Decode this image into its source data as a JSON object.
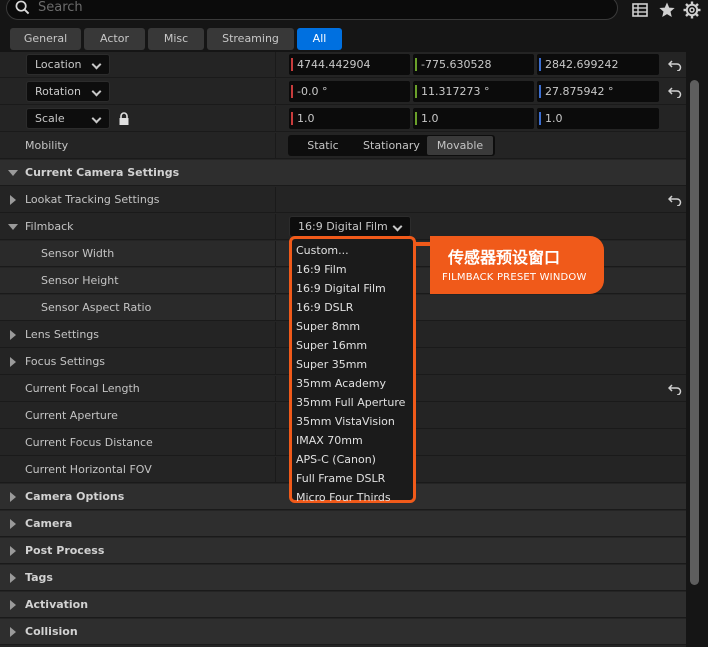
{
  "search": {
    "placeholder": "Search"
  },
  "toolbar_icons": [
    "table-icon",
    "star-icon",
    "gear-icon"
  ],
  "tabs": [
    {
      "label": "General",
      "active": false
    },
    {
      "label": "Actor",
      "active": false
    },
    {
      "label": "Misc",
      "active": false
    },
    {
      "label": "Streaming",
      "active": false
    },
    {
      "label": "All",
      "active": true
    }
  ],
  "transform": {
    "location": {
      "label": "Location",
      "x": "4744.442904",
      "y": "-775.630528",
      "z": "2842.699242"
    },
    "rotation": {
      "label": "Rotation",
      "x": "-0.0 °",
      "y": "11.317273 °",
      "z": "27.875942 °"
    },
    "scale": {
      "label": "Scale",
      "x": "1.0",
      "y": "1.0",
      "z": "1.0"
    },
    "mobility": {
      "label": "Mobility",
      "options": [
        "Static",
        "Stationary",
        "Movable"
      ],
      "selected": "Movable"
    }
  },
  "sections": {
    "current_camera_settings": "Current Camera Settings",
    "lookat_tracking": "Lookat Tracking Settings",
    "filmback": "Filmback",
    "filmback_value": "16:9 Digital Film",
    "sensor_width": "Sensor Width",
    "sensor_height": "Sensor Height",
    "sensor_aspect_ratio": "Sensor Aspect Ratio",
    "lens_settings": "Lens Settings",
    "focus_settings": "Focus Settings",
    "current_focal_length": "Current Focal Length",
    "current_aperture": "Current Aperture",
    "current_focus_distance": "Current Focus Distance",
    "current_horizontal_fov": "Current Horizontal FOV",
    "camera_options": "Camera Options",
    "camera": "Camera",
    "post_process": "Post Process",
    "tags": "Tags",
    "activation": "Activation",
    "collision": "Collision"
  },
  "dropdown": {
    "items": [
      "Custom...",
      "16:9 Film",
      "16:9 Digital Film",
      "16:9 DSLR",
      "Super 8mm",
      "Super 16mm",
      "Super 35mm",
      "35mm Academy",
      "35mm Full Aperture",
      "35mm VistaVision",
      "IMAX 70mm",
      "APS-C (Canon)",
      "Full Frame DSLR",
      "Micro Four Thirds"
    ]
  },
  "callout": {
    "title": "传感器预设窗口",
    "subtitle": "FILMBACK PRESET WINDOW"
  },
  "colors": {
    "accent": "#0070e0",
    "highlight": "#f05a1a",
    "x_axis": "#c83c3c",
    "y_axis": "#6aa02a",
    "z_axis": "#3c6ed0"
  }
}
